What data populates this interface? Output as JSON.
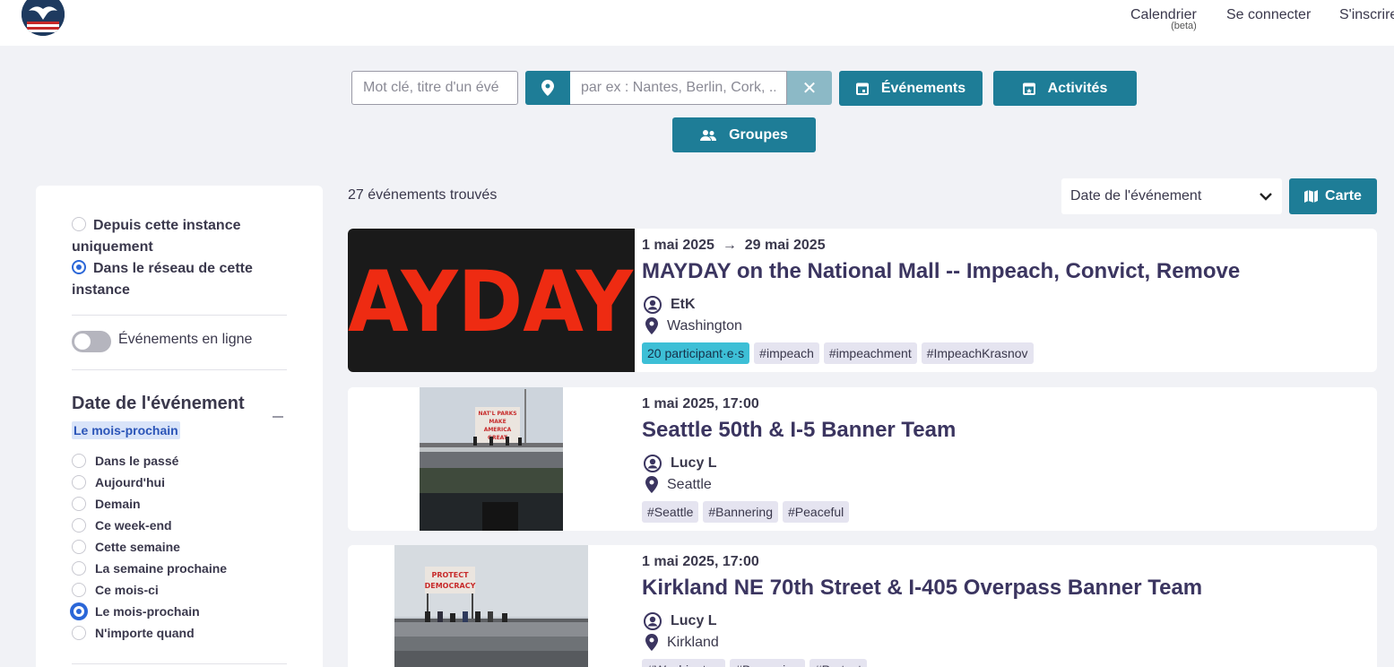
{
  "header": {
    "nav": {
      "calendar": "Calendrier",
      "calendar_badge": "(beta)",
      "login": "Se connecter",
      "signup": "S'inscrire"
    }
  },
  "search": {
    "keyword_placeholder": "Mot clé, titre d'un évé",
    "location_placeholder": "par ex : Nantes, Berlin, Cork, ..",
    "clear_icon": "close-icon",
    "events_label": "Événements",
    "activities_label": "Activités",
    "groups_label": "Groupes"
  },
  "sidebar": {
    "source_options": [
      {
        "label": "Depuis cette instance uniquement",
        "selected": false
      },
      {
        "label": "Dans le réseau de cette instance",
        "selected": true
      }
    ],
    "online_toggle_label": "Événements en ligne",
    "online_toggle_on": false,
    "date_filter": {
      "title": "Date de l'événement",
      "selected_badge": "Le mois-prochain",
      "options": [
        {
          "label": "Dans le passé",
          "selected": false
        },
        {
          "label": "Aujourd'hui",
          "selected": false
        },
        {
          "label": "Demain",
          "selected": false
        },
        {
          "label": "Ce week-end",
          "selected": false
        },
        {
          "label": "Cette semaine",
          "selected": false
        },
        {
          "label": "La semaine prochaine",
          "selected": false
        },
        {
          "label": "Ce mois-ci",
          "selected": false
        },
        {
          "label": "Le mois-prochain",
          "selected": true
        },
        {
          "label": "N'importe quand",
          "selected": false
        }
      ]
    }
  },
  "results": {
    "count_text": "27 événements trouvés",
    "sort_value": "Date de l'événement",
    "map_label": "Carte",
    "events": [
      {
        "date_start": "1 mai 2025",
        "date_end": "29 mai 2025",
        "title": "MAYDAY on the National Mall -- Impeach, Convict, Remove",
        "organizer": "EtK",
        "location": "Washington",
        "participants": "20 participant·e·s",
        "tags": [
          "#impeach",
          "#impeachment",
          "#ImpeachKrasnov"
        ],
        "image_text": "AYDAY"
      },
      {
        "date": "1 mai 2025, 17:00",
        "title": "Seattle 50th & I-5 Banner Team",
        "organizer": "Lucy L",
        "location": "Seattle",
        "tags": [
          "#Seattle",
          "#Bannering",
          "#Peaceful"
        ],
        "image_text": [
          "NAT'L PARKS",
          "MAKE",
          "AMERICA",
          "GREAT"
        ]
      },
      {
        "date": "1 mai 2025, 17:00",
        "title": "Kirkland NE 70th Street & I-405 Overpass Banner Team",
        "organizer": "Lucy L",
        "location": "Kirkland",
        "tags": [
          "#Washington",
          "#Bannering",
          "#Protest"
        ],
        "image_text": [
          "PROTECT",
          "DEMOCRACY"
        ]
      }
    ]
  },
  "colors": {
    "primary": "#1e7d97",
    "primary_light": "#8cb9c6",
    "title": "#3b3560",
    "background": "#f1f2f6",
    "participants_tag": "#3dbfd6",
    "tag": "#e5e4f0",
    "badge": "#d9e4f9",
    "radio_checked": "#2b67d8"
  }
}
